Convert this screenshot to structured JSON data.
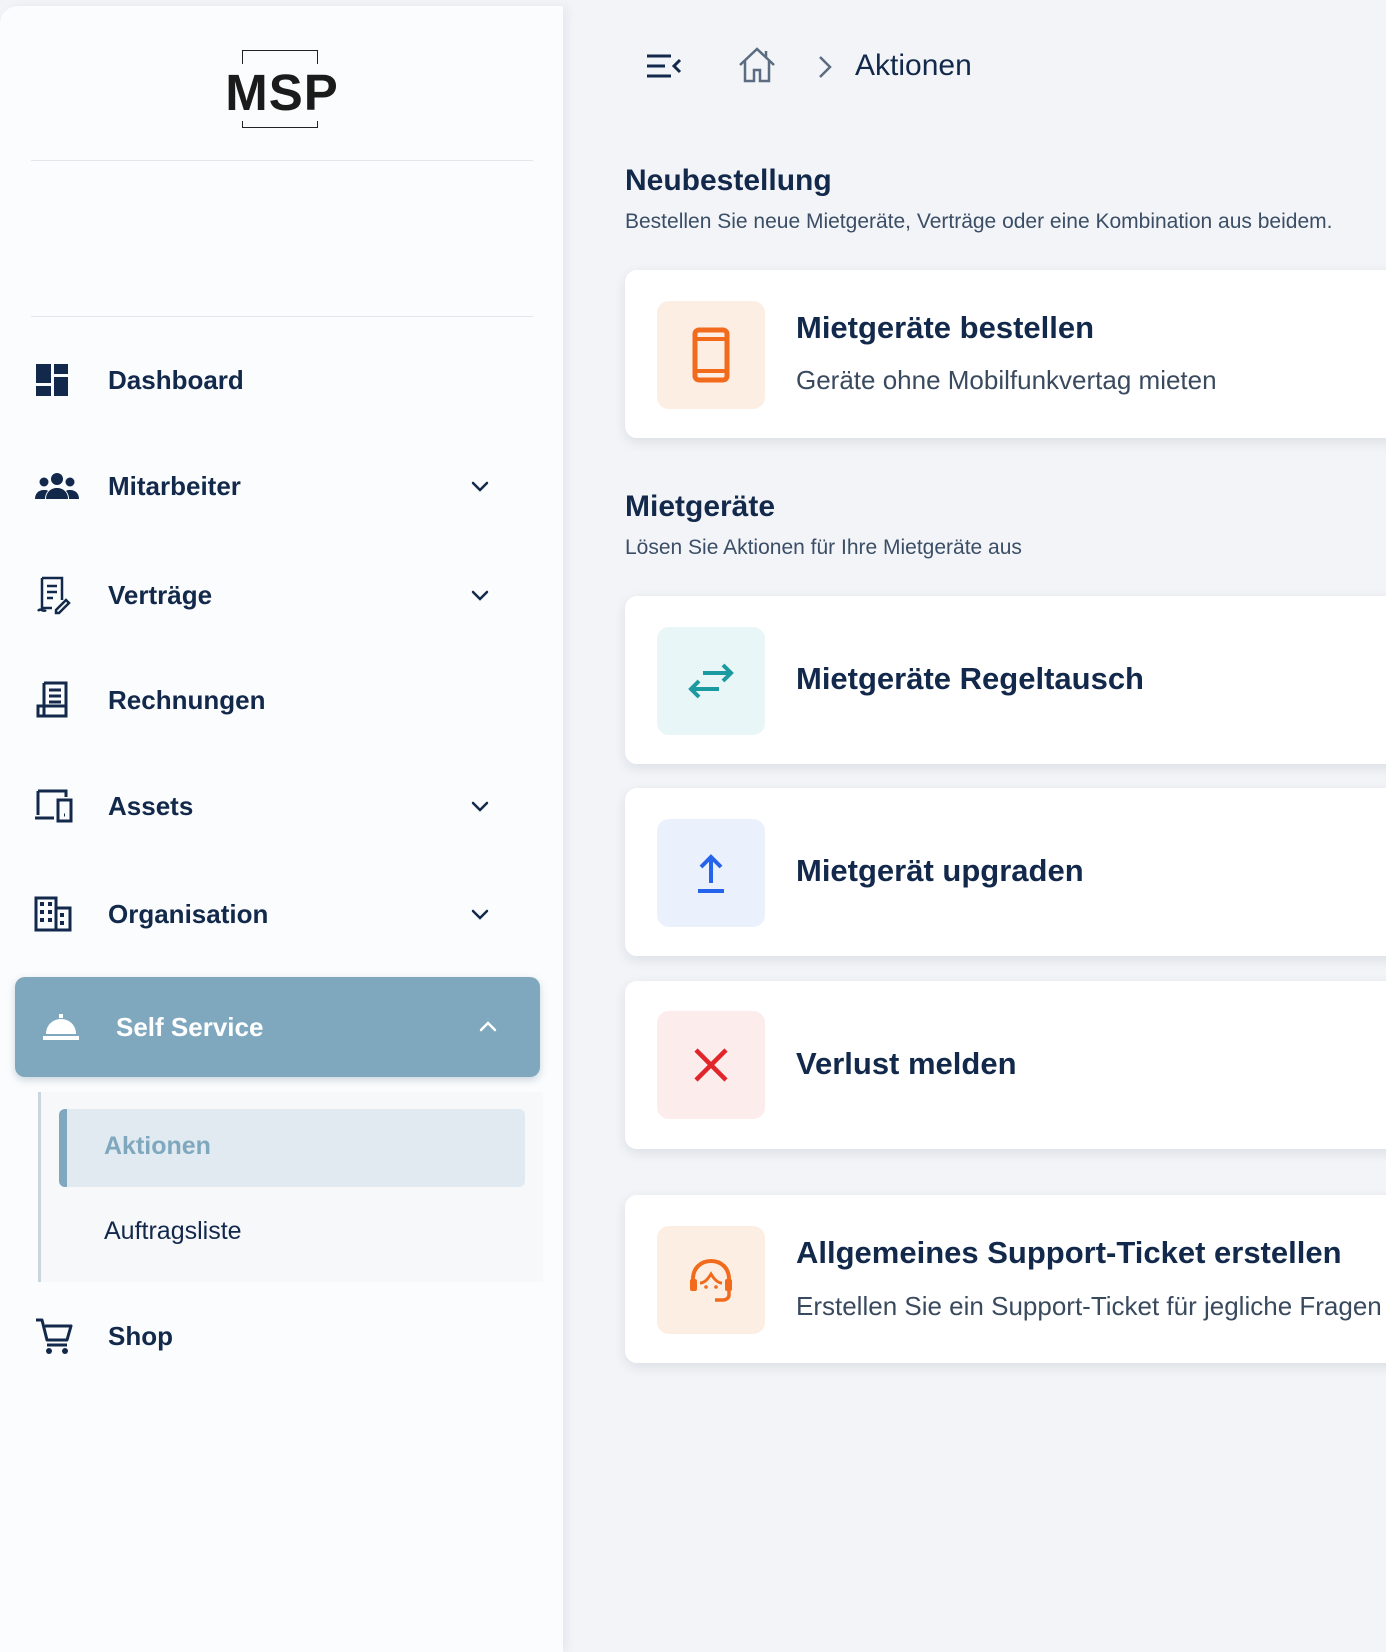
{
  "brand": {
    "logo_text": "MSP"
  },
  "sidebar": {
    "items": [
      {
        "label": "Dashboard",
        "icon": "dashboard-icon"
      },
      {
        "label": "Mitarbeiter",
        "icon": "people-icon",
        "expandable": true
      },
      {
        "label": "Verträge",
        "icon": "contract-icon",
        "expandable": true
      },
      {
        "label": "Rechnungen",
        "icon": "invoice-icon"
      },
      {
        "label": "Assets",
        "icon": "devices-icon",
        "expandable": true
      },
      {
        "label": "Organisation",
        "icon": "building-icon",
        "expandable": true
      },
      {
        "label": "Self Service",
        "icon": "service-bell-icon",
        "expanded": true,
        "active": true
      },
      {
        "label": "Shop",
        "icon": "cart-icon"
      }
    ],
    "self_service_sub": [
      {
        "label": "Aktionen",
        "active": true
      },
      {
        "label": "Auftragsliste"
      }
    ]
  },
  "header": {
    "breadcrumb_current": "Aktionen"
  },
  "sections": {
    "neubestellung": {
      "title": "Neubestellung",
      "subtitle": "Bestellen Sie neue Mietgeräte, Verträge oder eine Kombination aus beidem."
    },
    "mietgeraete": {
      "title": "Mietgeräte",
      "subtitle": "Lösen Sie Aktionen für Ihre Mietgeräte aus"
    }
  },
  "cards": {
    "order": {
      "title": "Mietgeräte bestellen",
      "desc": "Geräte ohne Mobilfunkvertag mieten"
    },
    "swap": {
      "title": "Mietgeräte Regeltausch"
    },
    "upgrade": {
      "title": "Mietgerät upgraden"
    },
    "loss": {
      "title": "Verlust melden"
    },
    "support": {
      "title": "Allgemeines Support-Ticket erstellen",
      "desc": "Erstellen Sie ein Support-Ticket für jegliche Fragen"
    }
  },
  "colors": {
    "navy": "#13294b",
    "accent": "#7fa8bf",
    "orange": "#f26b1d",
    "teal": "#1b9aa0",
    "blue": "#2563eb",
    "red": "#e0252b"
  }
}
